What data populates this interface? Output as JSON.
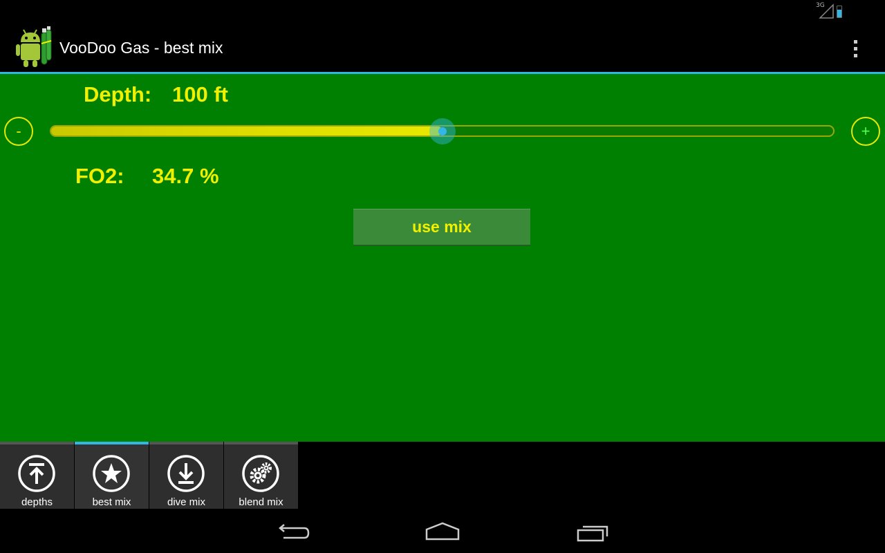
{
  "status_bar": {
    "network_type": "3G",
    "battery_level": 0.7,
    "accent": "#33b5e5"
  },
  "action_bar": {
    "title": "VooDoo Gas - best mix",
    "app_icon": "android-diver-icon",
    "overflow": "overflow-menu-icon"
  },
  "colors": {
    "background": "#008000",
    "text": "#f0f000",
    "accent": "#33b5e5",
    "plus": "#52ff52"
  },
  "depth": {
    "label": "Depth:",
    "value": "100 ft"
  },
  "slider": {
    "minus_label": "-",
    "plus_label": "+",
    "fraction": 0.5
  },
  "fo2": {
    "label": "FO2:",
    "value": "34.7 %"
  },
  "use_mix_label": "use mix",
  "tabs": [
    {
      "label": "depths",
      "icon": "arrow-up-to-line-icon",
      "selected": false
    },
    {
      "label": "best mix",
      "icon": "star-icon",
      "selected": true
    },
    {
      "label": "dive mix",
      "icon": "arrow-down-to-line-icon",
      "selected": false
    },
    {
      "label": "blend mix",
      "icon": "gears-icon",
      "selected": false
    }
  ],
  "nav_bar": {
    "back": "back-icon",
    "home": "home-icon",
    "recents": "recents-icon"
  }
}
